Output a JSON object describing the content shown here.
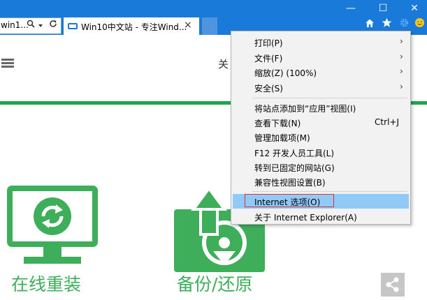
{
  "browser": {
    "address_text": "win1...",
    "tab_title": "Win10中文站 - 专注Wind...",
    "tab_close": "×",
    "window_controls": {
      "minimize": "—",
      "maximize": "☐",
      "close": "✕"
    },
    "toolbar_icons": [
      "home-icon",
      "favorites-star-icon",
      "settings-gear-icon",
      "feedback-smiley-icon"
    ],
    "colors": {
      "titlebar": "#1a7ad9",
      "menu_highlight": "#91c9f7",
      "focus_box": "#e03030"
    }
  },
  "page": {
    "nav_about": "关",
    "features": [
      {
        "label": "在线重装",
        "icon": "monitor-refresh-icon"
      },
      {
        "label": "备份/还原",
        "icon": "disk-backup-icon"
      }
    ],
    "share_icon": "share-icon",
    "colors": {
      "accent_green": "#3eae5b"
    }
  },
  "menu": {
    "group1": [
      {
        "label": "打印(P)",
        "arrow": "›"
      },
      {
        "label": "文件(F)",
        "arrow": "›"
      },
      {
        "label": "缩放(Z) (100%)",
        "arrow": "›"
      },
      {
        "label": "安全(S)",
        "arrow": "›"
      }
    ],
    "group2": [
      {
        "label": "将站点添加到“应用”视图(I)",
        "shortcut": ""
      },
      {
        "label": "查看下载(N)",
        "shortcut": "Ctrl+J"
      },
      {
        "label": "管理加载项(M)",
        "shortcut": ""
      },
      {
        "label": "F12 开发人员工具(L)",
        "shortcut": ""
      },
      {
        "label": "转到已固定的网站(G)",
        "shortcut": ""
      },
      {
        "label": "兼容性视图设置(B)",
        "shortcut": ""
      }
    ],
    "group3": [
      {
        "label": "Internet 选项(O)",
        "highlighted": true
      },
      {
        "label": "关于 Internet Explorer(A)",
        "highlighted": false
      }
    ]
  }
}
